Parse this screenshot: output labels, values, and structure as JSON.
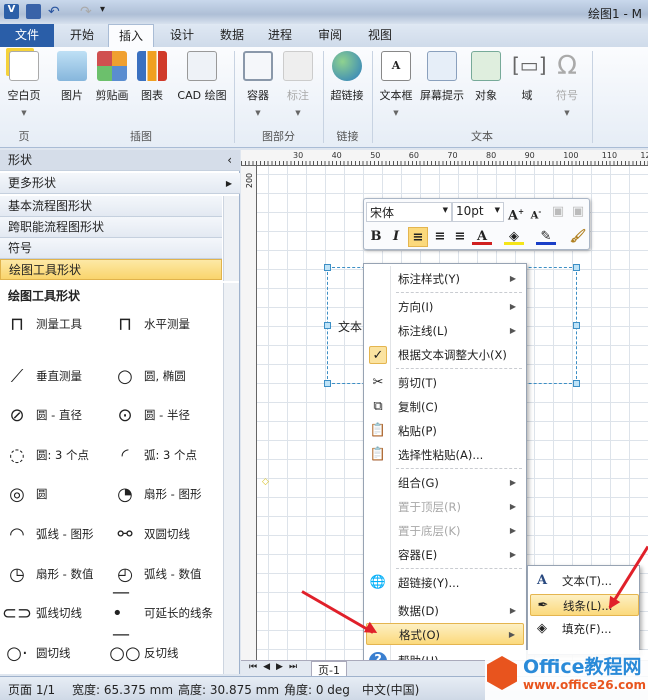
{
  "window": {
    "title": "绘图1 - M"
  },
  "quick_access": [
    "visio-logo-icon",
    "save-icon",
    "undo-icon",
    "redo-icon",
    "customize-icon"
  ],
  "tabs": [
    {
      "label": "文件"
    },
    {
      "label": "开始"
    },
    {
      "label": "插入",
      "active": true
    },
    {
      "label": "设计"
    },
    {
      "label": "数据"
    },
    {
      "label": "进程"
    },
    {
      "label": "审阅"
    },
    {
      "label": "视图"
    }
  ],
  "ribbon": {
    "buttons": [
      {
        "label": "空白页"
      },
      {
        "label": "图片"
      },
      {
        "label": "剪贴画"
      },
      {
        "label": "图表"
      },
      {
        "label": "CAD 绘图"
      },
      {
        "label": "容器"
      },
      {
        "label": "标注",
        "disabled": true
      },
      {
        "label": "超链接"
      },
      {
        "label": "文本框"
      },
      {
        "label": "屏幕提示"
      },
      {
        "label": "对象"
      },
      {
        "label": "域"
      },
      {
        "label": "符号",
        "disabled": true
      }
    ],
    "groups": [
      "页",
      "插图",
      "图部分",
      "链接",
      "文本"
    ]
  },
  "shapes_panel": {
    "title": "形状",
    "more": "更多形状",
    "stencils": [
      {
        "label": "基本流程图形状"
      },
      {
        "label": "跨职能流程图形状"
      },
      {
        "label": "符号"
      },
      {
        "label": "绘图工具形状",
        "selected": true
      }
    ],
    "stencil_title": "绘图工具形状",
    "items": [
      "测量工具",
      "水平测量",
      "垂直测量",
      "圆, 椭圆",
      "圆 - 直径",
      "圆 - 半径",
      "圆: 3 个点",
      "弧: 3 个点",
      "圆",
      "扇形 - 图形",
      "弧线 - 图形",
      "双圆切线",
      "扇形 - 数值",
      "弧线 - 数值",
      "弧线切线",
      "可延长的线条",
      "圆切线",
      "反切线"
    ]
  },
  "rulers": {
    "h": [
      "30",
      "40",
      "50",
      "60",
      "70",
      "80",
      "90",
      "100",
      "110",
      "120"
    ],
    "v": [
      "200"
    ]
  },
  "canvas": {
    "shape_text": "文本"
  },
  "mini_toolbar": {
    "font": "宋体",
    "size": "10pt",
    "accent_font": "#d02020",
    "accent_highlight": "#f5e51a",
    "accent_line": "#1a3fc8"
  },
  "context_menu": [
    {
      "label": "标注样式(Y)",
      "submenu": true
    },
    {
      "label": "方向(I)",
      "submenu": true
    },
    {
      "label": "标注线(L)",
      "submenu": true
    },
    {
      "label": "根据文本调整大小(X)",
      "checked": true
    },
    {
      "label": "剪切(T)",
      "icon": "cut-icon"
    },
    {
      "label": "复制(C)",
      "icon": "copy-icon"
    },
    {
      "label": "粘贴(P)",
      "icon": "paste-icon"
    },
    {
      "label": "选择性粘贴(A)...",
      "icon": "paste-special-icon"
    },
    {
      "label": "组合(G)",
      "submenu": true
    },
    {
      "label": "置于顶层(R)",
      "submenu": true,
      "disabled": true
    },
    {
      "label": "置于底层(K)",
      "submenu": true,
      "disabled": true
    },
    {
      "label": "容器(E)",
      "submenu": true
    },
    {
      "label": "超链接(Y)...",
      "icon": "hyperlink-icon"
    },
    {
      "label": "数据(D)",
      "submenu": true
    },
    {
      "label": "格式(O)",
      "submenu": true,
      "highlighted": true
    },
    {
      "label": "帮助(H)",
      "icon": "help-icon"
    }
  ],
  "format_submenu": [
    {
      "label": "文本(T)..."
    },
    {
      "label": "线条(L)...",
      "highlighted": true
    },
    {
      "label": "填充(F)..."
    }
  ],
  "page_tabs": {
    "current": "页-1"
  },
  "status_bar": {
    "page": "页面 1/1",
    "width": "宽度: 65.375 mm",
    "height": "高度: 30.875 mm",
    "angle": "角度: 0 deg",
    "language": "中文(中国)"
  },
  "watermark": {
    "brand": "Office教程网",
    "url": "www.office26.com"
  }
}
